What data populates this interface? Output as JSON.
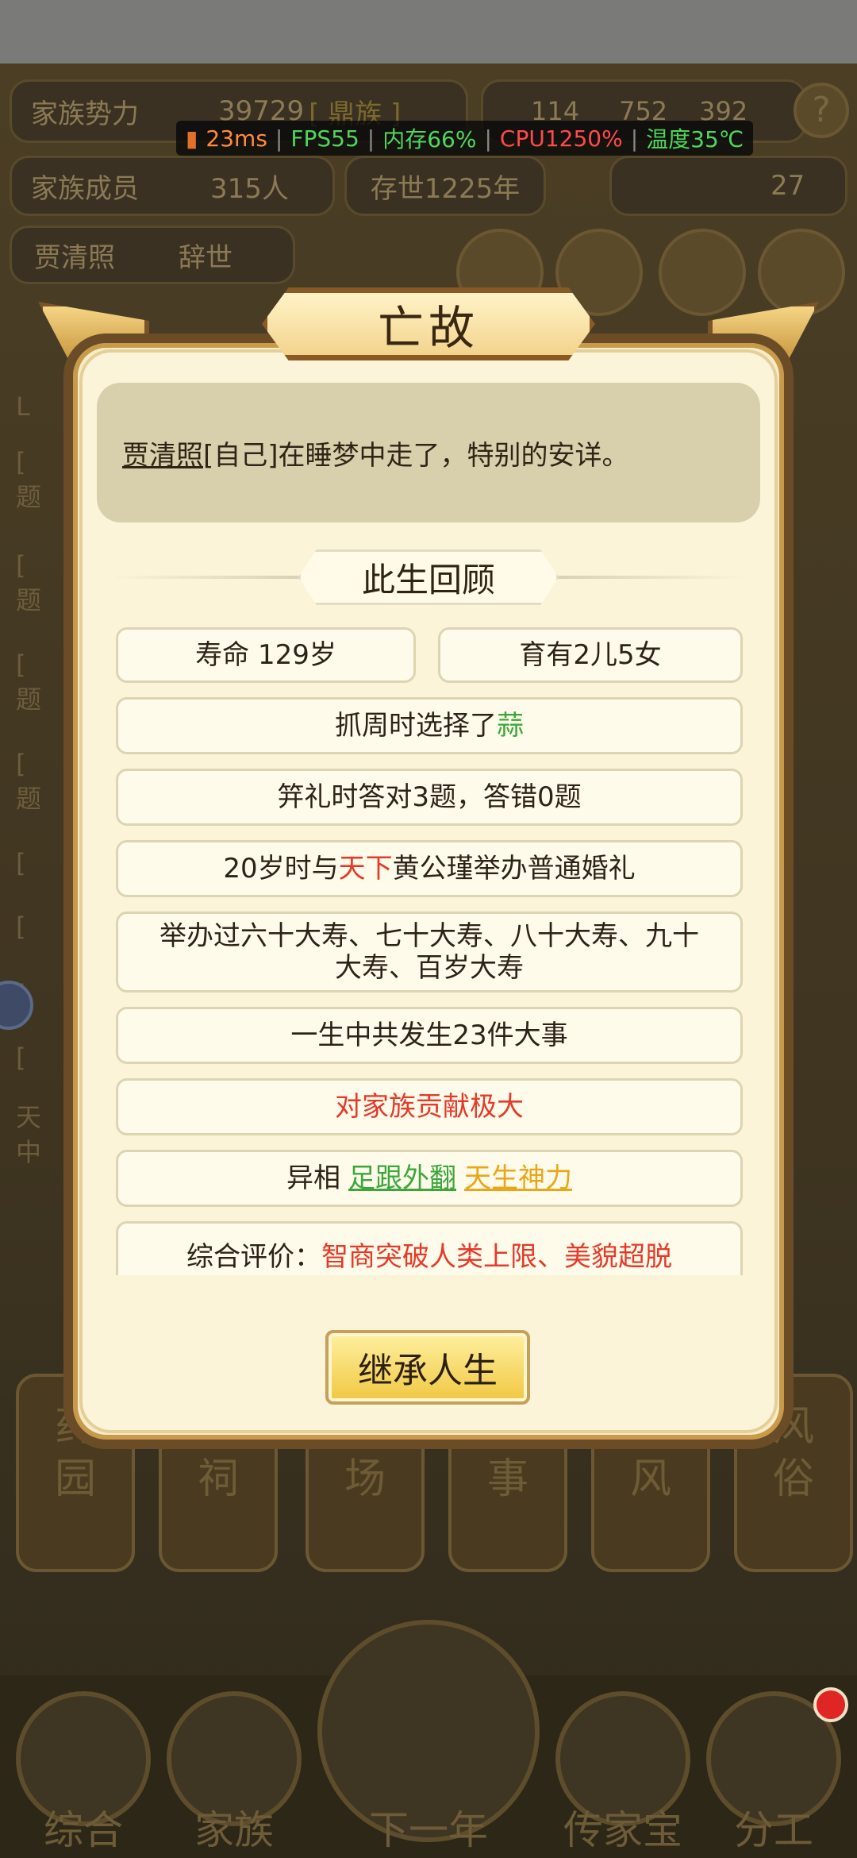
{
  "background": {
    "stats": {
      "power_label": "家族势力",
      "power_value": "39729",
      "power_rank": "[ 鼎族 ]",
      "members_label": "家族成员",
      "members_value": "315人",
      "years": "存世1225年",
      "person_name": "贾清照",
      "person_status": "辞世",
      "currency1": "114",
      "currency2": "752",
      "currency3": "392",
      "gold": "27"
    },
    "bottom_tabs": [
      "药\n园",
      "宗\n祠",
      "市\n场",
      "议\n事",
      "家\n风",
      "风\n俗"
    ],
    "nav": [
      "综合",
      "家族",
      "下一年",
      "传家宝",
      "分工"
    ]
  },
  "perf_overlay": {
    "latency": "23ms",
    "fps": "FPS55",
    "memory": "内存66%",
    "cpu": "CPU1250%",
    "temp": "温度35℃"
  },
  "modal": {
    "title": "亡故",
    "description": {
      "name": "贾清照",
      "text": "[自己]在睡梦中走了，特别的安详。"
    },
    "review_title": "此生回顾",
    "lifespan": "寿命 129岁",
    "children": "育有2儿5女",
    "zhuazhou_prefix": "抓周时选择了",
    "zhuazhou_item": "蒜",
    "jili": "笄礼时答对3题，答错0题",
    "wedding_prefix": "20岁时与",
    "wedding_place": "天下",
    "wedding_suffix": "黄公瑾举办普通婚礼",
    "birthdays": "举办过六十大寿、七十大寿、八十大寿、九十大寿、百岁大寿",
    "events": "一生中共发生23件大事",
    "contribution": "对家族贡献极大",
    "traits_prefix": "异相",
    "trait1": "足跟外翻",
    "trait2": "天生神力",
    "rating_prefix": "综合评价：",
    "rating_value": "智商突破人类上限、美貌超脱",
    "inherit_button": "继承人生"
  },
  "colors": {
    "modal_bg": "#fbf4d9",
    "modal_border": "#6a4c26",
    "green_text": "#3aa73a",
    "red_text": "#e43a2a",
    "gold_text": "#eaa619",
    "button_gold": "#f0c742"
  }
}
